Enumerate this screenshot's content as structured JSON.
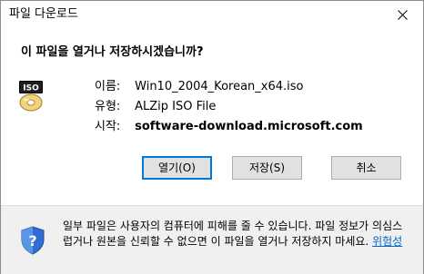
{
  "window": {
    "title": "파일 다운로드"
  },
  "dialog": {
    "question": "이 파일을 열거나 저장하시겠습니까?",
    "file_icon_label": "ISO",
    "fields": [
      {
        "label": "이름:",
        "value": "Win10_2004_Korean_x64.iso"
      },
      {
        "label": "유형:",
        "value": "ALZip ISO File"
      },
      {
        "label": "시작:",
        "value": "software-download.microsoft.com"
      }
    ]
  },
  "buttons": {
    "open": "열기(O)",
    "save": "저장(S)",
    "cancel": "취소"
  },
  "footer": {
    "warning_text": "일부 파일은 사용자의 컴퓨터에 피해를 줄 수 있습니다. 파일 정보가 의심스럽거나 원본을 신뢰할 수 없으면 이 파일을 열거나 저장하지 마세요.",
    "link_text": "위험성"
  },
  "colors": {
    "accent": "#0078d7",
    "link": "#0066cc",
    "footer_bg": "#f0f0f0"
  }
}
